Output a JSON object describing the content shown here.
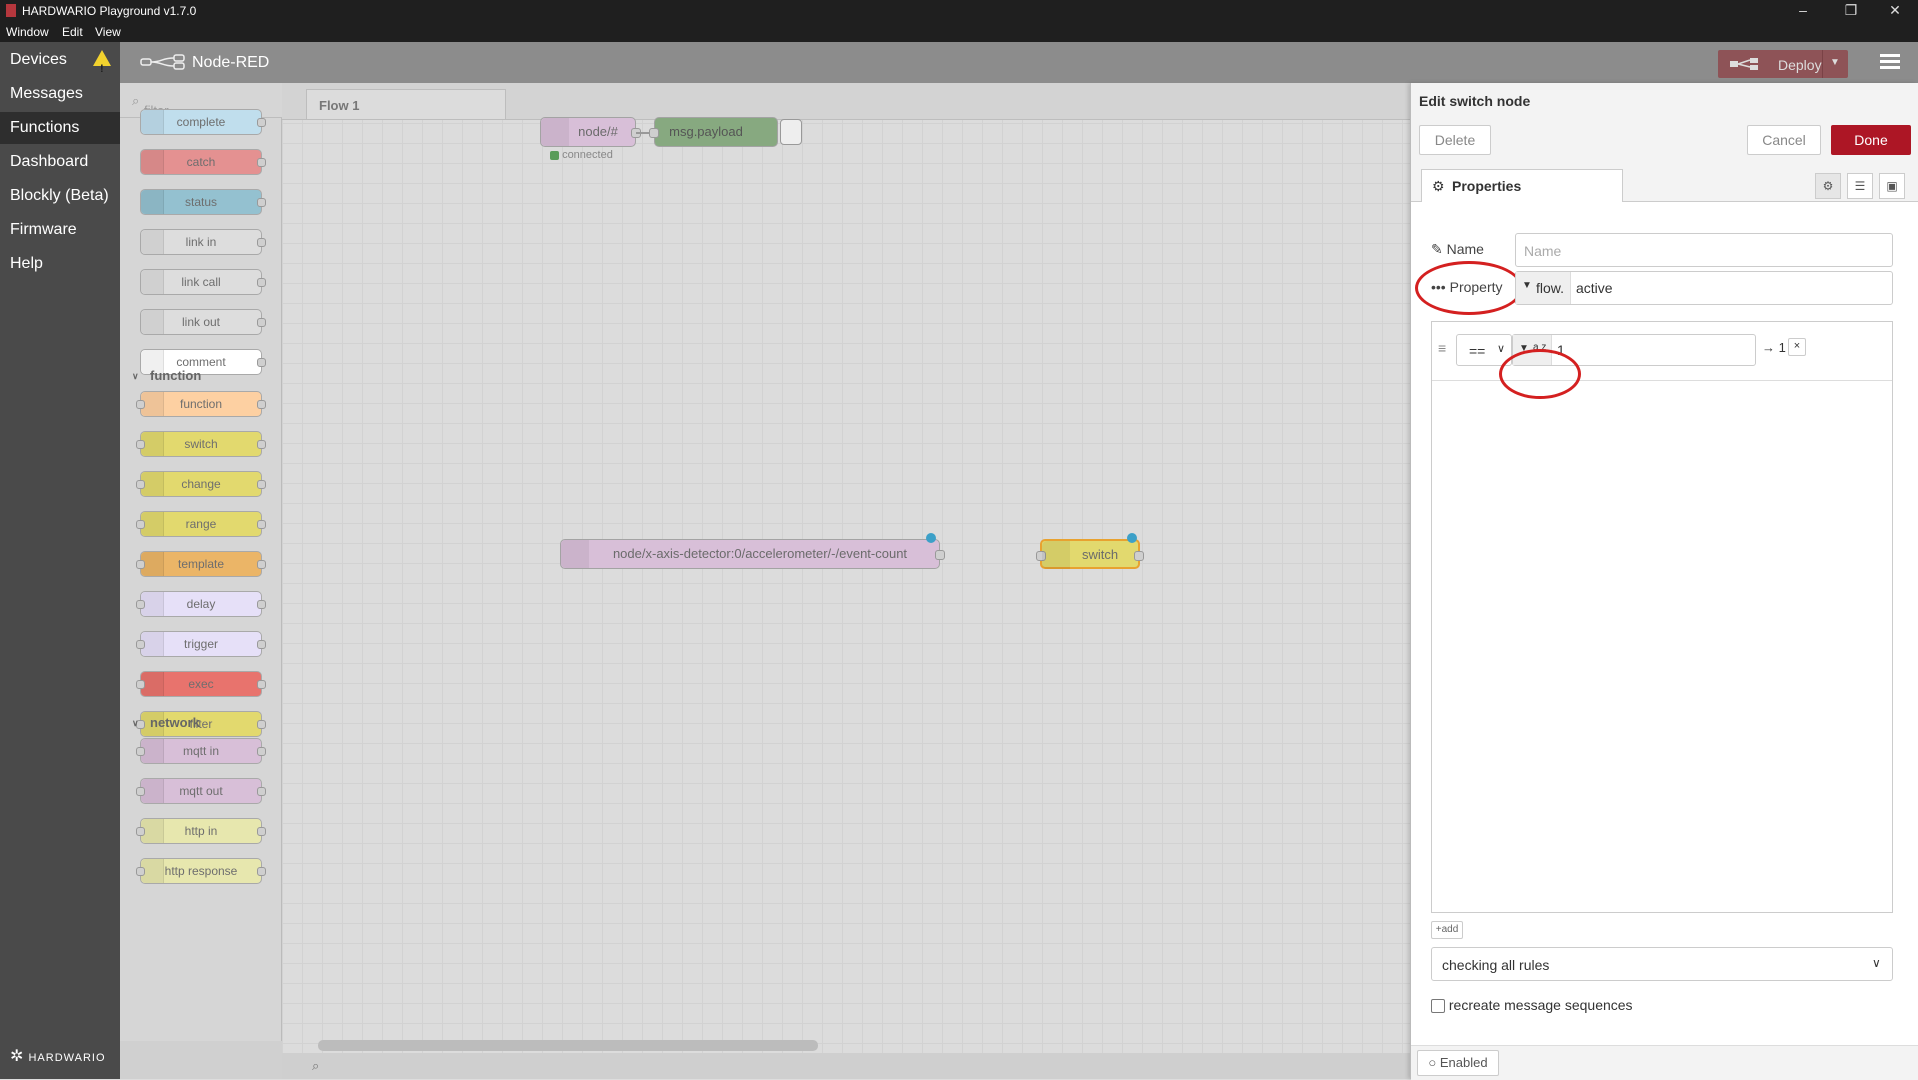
{
  "window": {
    "title": "HARDWARIO Playground v1.7.0",
    "menu": [
      "Window",
      "Edit",
      "View"
    ],
    "controls": {
      "minimize": "–",
      "maximize": "❐",
      "close": "✕"
    }
  },
  "app_nav": {
    "items": [
      "Devices",
      "Messages",
      "Functions",
      "Dashboard",
      "Blockly (Beta)",
      "Firmware",
      "Help"
    ],
    "active": "Functions",
    "warning_symbol": "!",
    "brand": "HARDWARIO"
  },
  "header": {
    "title": "Node-RED",
    "deploy_label": "Deploy"
  },
  "palette": {
    "filter_placeholder": "filter nodes",
    "common_nodes": [
      {
        "label": "complete",
        "color": "#c0deed"
      },
      {
        "label": "catch",
        "color": "#e49191"
      },
      {
        "label": "status",
        "color": "#94c1d0"
      },
      {
        "label": "link in",
        "color": "#dddddd"
      },
      {
        "label": "link call",
        "color": "#dddddd"
      },
      {
        "label": "link out",
        "color": "#dddddd"
      },
      {
        "label": "comment",
        "color": "#ffffff"
      }
    ],
    "categories": {
      "function": "function",
      "network": "network"
    },
    "function_nodes": [
      {
        "label": "function",
        "color": "#fdd0a2"
      },
      {
        "label": "switch",
        "color": "#e2d96e"
      },
      {
        "label": "change",
        "color": "#e2d96e"
      },
      {
        "label": "range",
        "color": "#e2d96e"
      },
      {
        "label": "template",
        "color": "#ebb567"
      },
      {
        "label": "delay",
        "color": "#e6e0f8"
      },
      {
        "label": "trigger",
        "color": "#e6e0f8"
      },
      {
        "label": "exec",
        "color": "#e8736d"
      },
      {
        "label": "filter",
        "color": "#e2d96e"
      }
    ],
    "network_nodes": [
      {
        "label": "mqtt in",
        "color": "#d8bfd8"
      },
      {
        "label": "mqtt out",
        "color": "#d8bfd8"
      },
      {
        "label": "http in",
        "color": "#e7e7ae"
      },
      {
        "label": "http response",
        "color": "#e7e7ae"
      }
    ]
  },
  "workspace": {
    "tab": "Flow 1",
    "nodes": {
      "mqtt_node": "node/#",
      "mqtt_status": "connected",
      "debug_node": "msg.payload",
      "mqtt_topic_node": "node/x-axis-detector:0/accelerometer/-/event-count",
      "switch_node": "switch"
    }
  },
  "tray": {
    "title": "Edit switch node",
    "delete_label": "Delete",
    "cancel_label": "Cancel",
    "done_label": "Done",
    "properties_tab": "Properties",
    "name_label": "Name",
    "name_placeholder": "Name",
    "property_label": "Property",
    "property_type": "flow.",
    "property_value": "active",
    "rule": {
      "operator": "==",
      "value_type": "a z",
      "value": "1",
      "output": "→ 1",
      "remove": "×"
    },
    "add_label": "add",
    "mode_select": "checking all rules",
    "recreate_label": "recreate message sequences",
    "enabled_label": "Enabled"
  }
}
